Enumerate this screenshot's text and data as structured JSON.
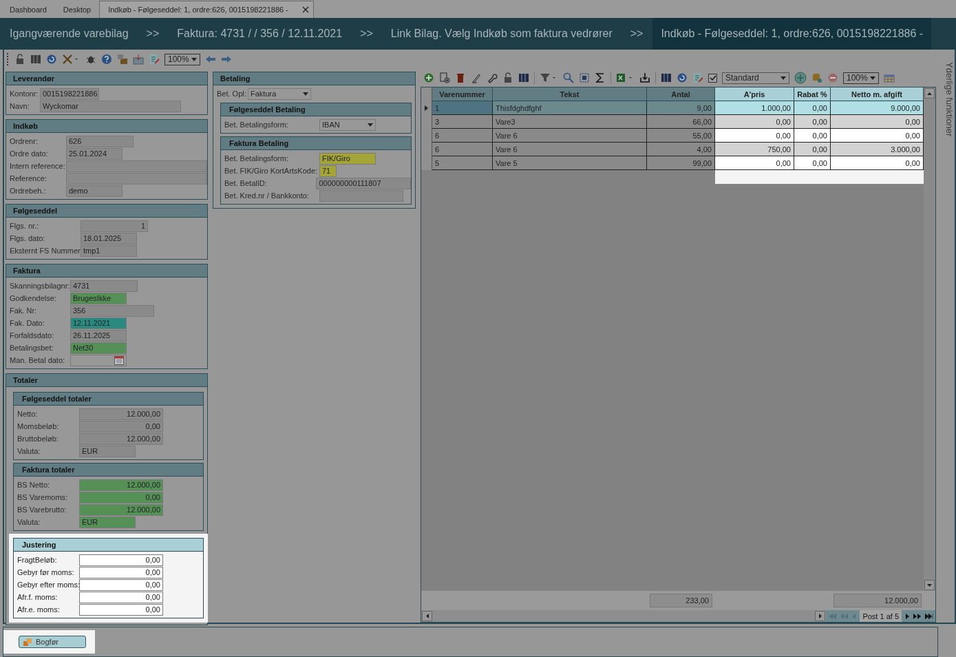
{
  "tabs": [
    {
      "label": "Dashboard",
      "selected": false,
      "closable": false
    },
    {
      "label": "Desktop",
      "selected": false,
      "closable": false
    },
    {
      "label": "Indkøb - Følgeseddel: 1, ordre:626, 0015198221886 -",
      "selected": true,
      "closable": true
    }
  ],
  "breadcrumb": [
    {
      "kind": "crumb",
      "label": "Igangværende varebilag",
      "selected": false
    },
    {
      "kind": "separator",
      "label": ">>"
    },
    {
      "kind": "crumb",
      "label": "Faktura: 4731 /  / 356 / 12.11.2021",
      "selected": false
    },
    {
      "kind": "separator",
      "label": ">>"
    },
    {
      "kind": "crumb",
      "label": "Link Bilag. Vælg Indkøb som faktura vedrører",
      "selected": false
    },
    {
      "kind": "separator",
      "label": ">>"
    },
    {
      "kind": "crumb",
      "label": "Indkøb - Følgeseddel: 1, ordre:626, 0015198221886 -",
      "selected": true
    }
  ],
  "toolbar": {
    "zoom": "100%"
  },
  "left_sections": [
    {
      "title": "Leverandør",
      "highlighted": false,
      "fields": [
        {
          "label": "Kontonr:",
          "value": "0015198221886",
          "kind": "text",
          "color": "#8a8a8a"
        },
        {
          "label": "Navn:",
          "value": "Wyckomar",
          "kind": "text",
          "color": "#8a8a8a"
        }
      ]
    },
    {
      "title": "Indkøb",
      "highlighted": false,
      "fields": [
        {
          "label": "Ordrenr:",
          "value": "626",
          "kind": "text",
          "color": "#8a8a8a"
        },
        {
          "label": "Ordre dato:",
          "value": "25.01.2024",
          "kind": "text",
          "color": "#8a8a8a"
        },
        {
          "label": "Intern reference:",
          "kind": "text",
          "color": "#8a8a8a"
        },
        {
          "label": "Reference:",
          "kind": "text",
          "color": "#8a8a8a"
        },
        {
          "label": "Ordrebeh.:",
          "value": "demo",
          "kind": "text",
          "color": "#8a8a8a"
        }
      ]
    },
    {
      "title": "Følgeseddel",
      "highlighted": false,
      "fields": [
        {
          "label": "Flgs. nr.:",
          "value": "1",
          "kind": "number",
          "color": "#8a8a8a"
        },
        {
          "label": "Flgs. dato:",
          "value": "18.01.2025",
          "kind": "text",
          "color": "#8a8a8a"
        },
        {
          "label": "Eksternt FS Nummer:",
          "value": "tmp1",
          "kind": "text",
          "color": "#8a8a8a"
        }
      ]
    },
    {
      "title": "Faktura",
      "highlighted": false,
      "fields": [
        {
          "label": "Skanningsbilagnr:",
          "value": "4731",
          "kind": "text",
          "color": "#8a8a8a"
        },
        {
          "label": "Godkendelse:",
          "value": "BrugesIkke",
          "kind": "text",
          "color": "#559157"
        },
        {
          "label": "Fak. Nr:",
          "value": "356",
          "kind": "text",
          "color": "#8a8a8a"
        },
        {
          "label": "Fak. Dato:",
          "value": "12.11.2021",
          "kind": "text",
          "color": "#2b8a80"
        },
        {
          "label": "Forfaldsdato:",
          "value": "26.11.2025",
          "kind": "text",
          "color": "#8a8a8a"
        },
        {
          "label": "Betalingsbet:",
          "value": "Net30",
          "kind": "text",
          "color": "#559157"
        },
        {
          "label": "Man. Betal dato:",
          "kind": "date",
          "color": "#989898"
        }
      ]
    },
    {
      "title": "Totaler",
      "highlighted": false,
      "children": [
        {
          "title": "Følgeseddel totaler",
          "highlighted": false,
          "fields": [
            {
              "label": "Netto:",
              "value": "12.000,00",
              "kind": "number",
              "color": "#8a8a8a"
            },
            {
              "label": "Momsbeløb:",
              "value": "0,00",
              "kind": "number",
              "color": "#8a8a8a"
            },
            {
              "label": "Bruttobeløb:",
              "value": "12.000,00",
              "kind": "number",
              "color": "#8a8a8a"
            },
            {
              "label": "Valuta:",
              "value": "EUR",
              "kind": "text",
              "color": "#8a8a8a"
            }
          ]
        },
        {
          "title": "Faktura totaler",
          "highlighted": false,
          "fields": [
            {
              "label": "BS Netto:",
              "value": "12.000,00",
              "kind": "number",
              "color": "#559157"
            },
            {
              "label": "BS Varemoms:",
              "value": "0,00",
              "kind": "number",
              "color": "#559157"
            },
            {
              "label": "BS Varebrutto:",
              "value": "12.000,00",
              "kind": "number",
              "color": "#559157"
            },
            {
              "label": "Valuta:",
              "value": "EUR",
              "kind": "text",
              "color": "#559157"
            }
          ]
        },
        {
          "title": "Justering",
          "highlighted": true,
          "fields": [
            {
              "label": "FragtBeløb:",
              "value": "0,00",
              "kind": "number",
              "color": "#ffffff"
            },
            {
              "label": "Gebyr før moms:",
              "value": "0,00",
              "kind": "number",
              "color": "#ffffff"
            },
            {
              "label": "Gebyr efter moms:",
              "value": "0,00",
              "kind": "number",
              "color": "#ffffff"
            },
            {
              "label": "Afr.f. moms:",
              "value": "0,00",
              "kind": "number",
              "color": "#ffffff"
            },
            {
              "label": "Afr.e. moms:",
              "value": "0,00",
              "kind": "number",
              "color": "#ffffff"
            }
          ]
        }
      ]
    }
  ],
  "payment_section": {
    "title": "Betaling",
    "highlighted": false,
    "fields": [
      {
        "label": "Bet. Opl:",
        "value": "Faktura",
        "kind": "dropdown",
        "color": "#989898"
      }
    ],
    "children": [
      {
        "title": "Følgeseddel Betaling",
        "highlighted": false,
        "fields": [
          {
            "label": "Bet. Betalingsform:",
            "value": "IBAN",
            "kind": "dropdown",
            "color": "#989898"
          }
        ]
      },
      {
        "title": "Faktura Betaling",
        "highlighted": false,
        "fields": [
          {
            "label": "Bet. Betalingsform:",
            "value": "FIK/Giro",
            "kind": "text",
            "color": "#a5a438"
          },
          {
            "label": "Bet. FIK/Giro KortArtsKode:",
            "value": "71",
            "kind": "text",
            "color": "#a5a438"
          },
          {
            "label": "Bet. BetalID:",
            "value": "000000000111807",
            "kind": "text",
            "color": "#8a8a8a"
          },
          {
            "label": "Bet. Kred.nr / Bankkonto:",
            "kind": "text",
            "color": "#8a8a8a"
          }
        ]
      }
    ]
  },
  "grid_toolbar": {
    "show_checked": true,
    "layout": "Standard",
    "zoom": "100%"
  },
  "table": {
    "columns": [
      {
        "label": "Varenummer",
        "highlighted": false
      },
      {
        "label": "Tekst",
        "highlighted": false
      },
      {
        "label": "Antal",
        "highlighted": false
      },
      {
        "label": "A'pris",
        "highlighted": true
      },
      {
        "label": "Rabat %",
        "highlighted": true
      },
      {
        "label": "Netto m. afgift",
        "highlighted": true
      }
    ],
    "rows": [
      {
        "selected": true,
        "cells": [
          "1",
          "Thisfdghdfghf",
          "9,00",
          "1.000,00",
          "0,00",
          "9.000,00"
        ]
      },
      {
        "selected": false,
        "cells": [
          "3",
          "Vare3",
          "66,00",
          "0,00",
          "0,00",
          "0,00"
        ]
      },
      {
        "selected": false,
        "cells": [
          "6",
          "Vare 6",
          "55,00",
          "0,00",
          "0,00",
          "0,00"
        ]
      },
      {
        "selected": false,
        "cells": [
          "6",
          "Vare 6",
          "4,00",
          "750,00",
          "0,00",
          "3.000,00"
        ]
      },
      {
        "selected": false,
        "cells": [
          "5",
          "Vare 5",
          "99,00",
          "0,00",
          "0,00",
          "0,00"
        ]
      }
    ],
    "totals": {
      "antal": "233,00",
      "netto": "12.000,00"
    },
    "pager": "Post 1 af 5"
  },
  "side_panel": "Yderlige funktioner",
  "footer": {
    "button": {
      "label": "Bogfør",
      "highlighted": true
    }
  }
}
